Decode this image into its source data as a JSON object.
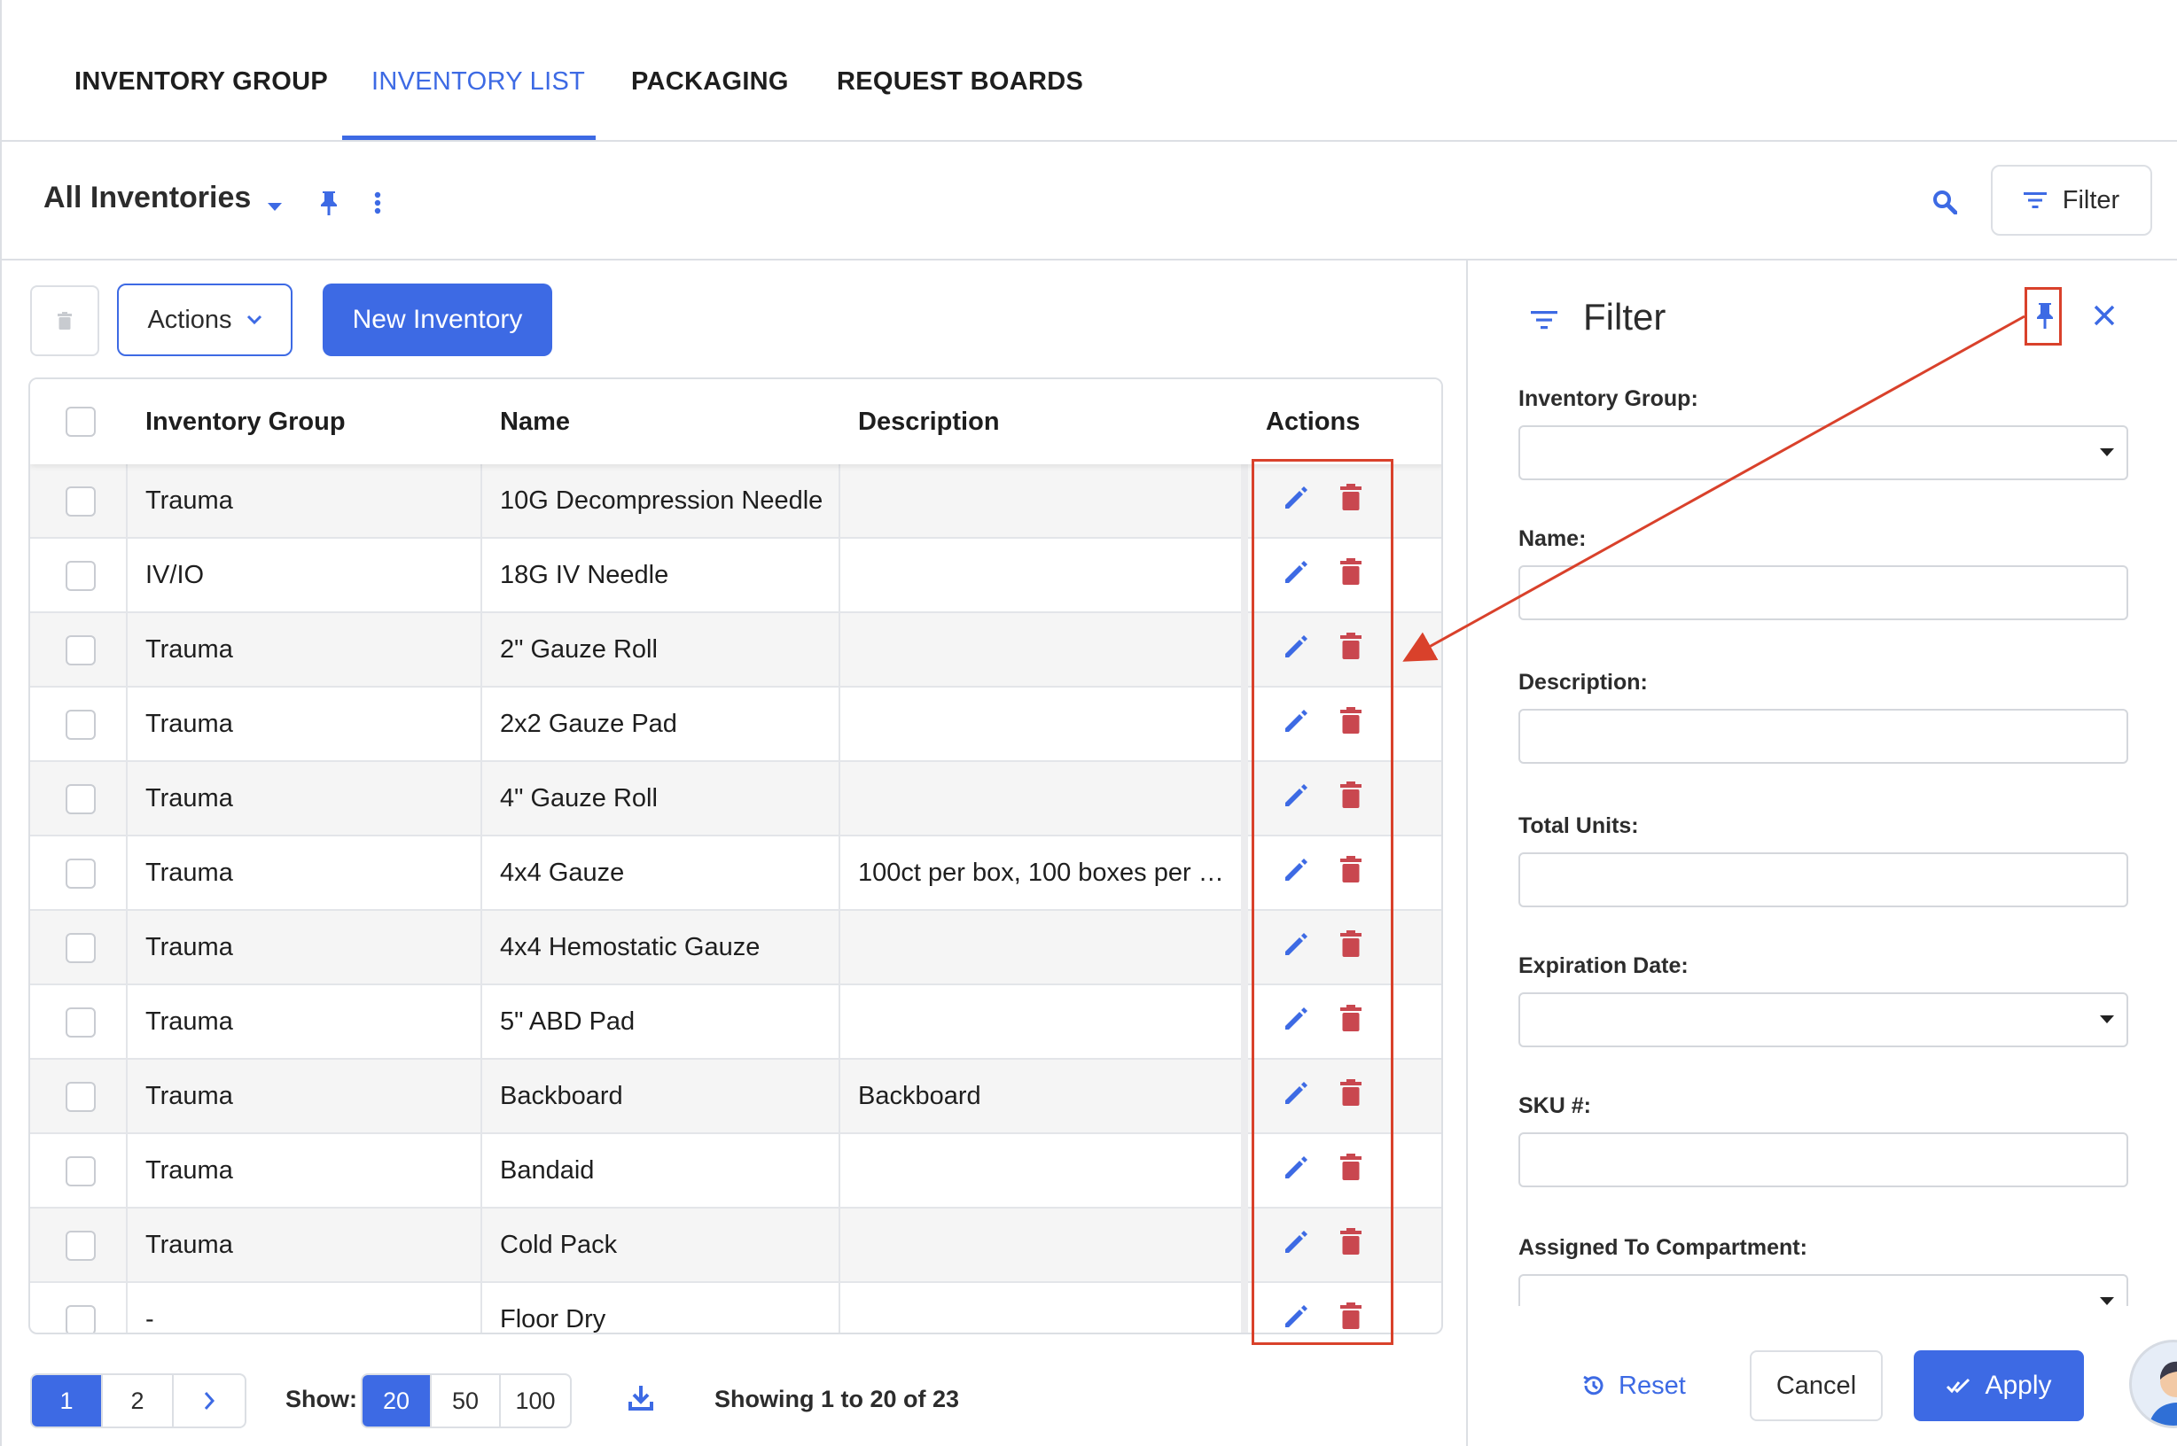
{
  "tabs": [
    {
      "label": "INVENTORY GROUP",
      "active": false
    },
    {
      "label": "INVENTORY LIST",
      "active": true
    },
    {
      "label": "PACKAGING",
      "active": false
    },
    {
      "label": "REQUEST BOARDS",
      "active": false
    }
  ],
  "toolbar": {
    "view_title": "All Inventories",
    "filter_label": "Filter"
  },
  "actions_bar": {
    "actions_label": "Actions",
    "new_label": "New Inventory"
  },
  "table": {
    "columns": [
      "Inventory Group",
      "Name",
      "Description",
      "Actions"
    ],
    "rows": [
      {
        "group": "Trauma",
        "name": "10G Decompression Needle",
        "description": ""
      },
      {
        "group": "IV/IO",
        "name": "18G IV Needle",
        "description": ""
      },
      {
        "group": "Trauma",
        "name": "2\" Gauze Roll",
        "description": ""
      },
      {
        "group": "Trauma",
        "name": "2x2 Gauze Pad",
        "description": ""
      },
      {
        "group": "Trauma",
        "name": "4\" Gauze Roll",
        "description": ""
      },
      {
        "group": "Trauma",
        "name": "4x4 Gauze",
        "description": "100ct per box, 100 boxes per …"
      },
      {
        "group": "Trauma",
        "name": "4x4 Hemostatic Gauze",
        "description": ""
      },
      {
        "group": "Trauma",
        "name": "5\" ABD Pad",
        "description": ""
      },
      {
        "group": "Trauma",
        "name": "Backboard",
        "description": "Backboard"
      },
      {
        "group": "Trauma",
        "name": "Bandaid",
        "description": ""
      },
      {
        "group": "Trauma",
        "name": "Cold Pack",
        "description": ""
      },
      {
        "group": "-",
        "name": "Floor Dry",
        "description": ""
      }
    ]
  },
  "pagination": {
    "pages": [
      "1",
      "2"
    ],
    "next_icon": "chevron-right-icon",
    "show_label": "Show:",
    "sizes": [
      "20",
      "50",
      "100"
    ],
    "active_size": "20",
    "showing_text": "Showing 1 to 20 of 23"
  },
  "filter_panel": {
    "title": "Filter",
    "fields": {
      "inventory_group": "Inventory Group:",
      "name": "Name:",
      "description": "Description:",
      "total_units": "Total Units:",
      "expiration_date": "Expiration Date:",
      "sku": "SKU #:",
      "assigned": "Assigned To Compartment:"
    },
    "reset_label": "Reset",
    "cancel_label": "Cancel",
    "apply_label": "Apply"
  },
  "colors": {
    "accent": "#3d6ae4",
    "delete": "#c9474f",
    "annotation": "#d9412b"
  }
}
